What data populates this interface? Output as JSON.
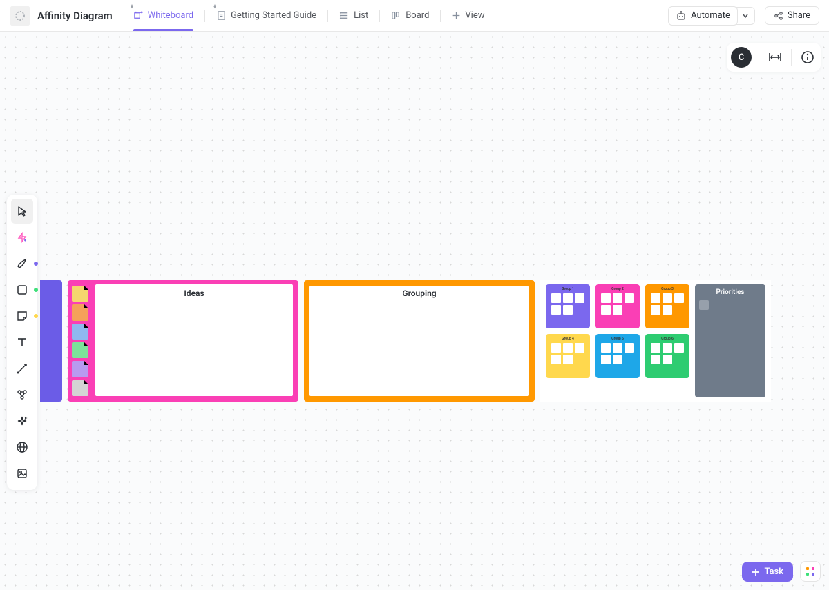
{
  "header": {
    "title": "Affinity Diagram",
    "tabs": [
      {
        "label": "Whiteboard",
        "icon": "whiteboard-icon",
        "active": true,
        "pinned": true
      },
      {
        "label": "Getting Started Guide",
        "icon": "doc-icon",
        "active": false,
        "pinned": true
      },
      {
        "label": "List",
        "icon": "list-icon",
        "active": false
      },
      {
        "label": "Board",
        "icon": "board-icon",
        "active": false
      },
      {
        "label": "View",
        "icon": "plus-icon",
        "active": false,
        "add": true
      }
    ],
    "automate_label": "Automate",
    "share_label": "Share"
  },
  "canvas_controls": {
    "avatar_initial": "C"
  },
  "toolbar": {
    "tools": [
      {
        "name": "select",
        "icon": "cursor-icon",
        "active": true
      },
      {
        "name": "ai",
        "icon": "ai-icon"
      },
      {
        "name": "pen",
        "icon": "pen-icon",
        "dot": "#7b68ee"
      },
      {
        "name": "shape",
        "icon": "square-icon",
        "dot": "#3ee07a"
      },
      {
        "name": "sticky",
        "icon": "sticky-icon",
        "dot": "#ffd84d"
      },
      {
        "name": "text",
        "icon": "text-icon"
      },
      {
        "name": "connector",
        "icon": "connector-icon"
      },
      {
        "name": "more",
        "icon": "nodes-icon"
      },
      {
        "name": "sparkle",
        "icon": "sparkle-icon"
      },
      {
        "name": "web",
        "icon": "globe-icon"
      },
      {
        "name": "image",
        "icon": "image-icon"
      }
    ]
  },
  "board": {
    "ideas_label": "Ideas",
    "grouping_label": "Grouping",
    "priorities_label": "Priorities",
    "sticky_colors": [
      "#f5d76e",
      "#f5a15a",
      "#8fb8f0",
      "#7de29a",
      "#b89af0",
      "#d4d4d4"
    ],
    "group_cards": [
      {
        "color": "#7b68ee",
        "title": "Group 1"
      },
      {
        "color": "#fa3fb5",
        "title": "Group 2"
      },
      {
        "color": "#ff9800",
        "title": "Group 3"
      },
      {
        "color": "#ffd84d",
        "title": "Group 4"
      },
      {
        "color": "#1ea7e8",
        "title": "Group 5"
      },
      {
        "color": "#2ecc71",
        "title": "Group 6"
      }
    ]
  },
  "footer": {
    "task_label": "Task"
  }
}
